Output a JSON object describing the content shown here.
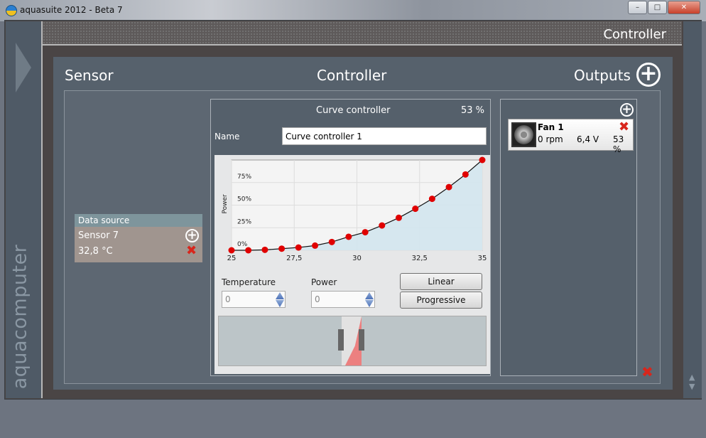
{
  "window": {
    "title": "aquasuite 2012 - Beta 7",
    "min": "–",
    "max": "□",
    "close": "✕"
  },
  "sidebar": {
    "brand": "aquacomputer"
  },
  "page_header": "Controller",
  "sections": {
    "sensor": "Sensor",
    "controller": "Controller",
    "outputs": "Outputs"
  },
  "data_source": {
    "header": "Data source",
    "sensor": "Sensor 7",
    "value": "32,8 °C"
  },
  "controller": {
    "type": "Curve controller",
    "power": "53 %",
    "name_label": "Name",
    "name_value": "Curve controller 1",
    "temperature_label": "Temperature",
    "temperature_value": "0",
    "power_label": "Power",
    "power_value": "0",
    "linear": "Linear",
    "progressive": "Progressive"
  },
  "outputs": [
    {
      "name": "Fan 1",
      "rpm": "0 rpm",
      "voltage": "6,4 V",
      "power": "53 %"
    }
  ],
  "chart_data": {
    "type": "line",
    "xlabel": "",
    "ylabel": "Power",
    "xlim": [
      25,
      35
    ],
    "ylim": [
      0,
      100
    ],
    "x_ticks": [
      "25",
      "27,5",
      "30",
      "32,5",
      "35"
    ],
    "y_ticks": [
      "0%",
      "25%",
      "50%",
      "75%"
    ],
    "grid": true,
    "x": [
      25,
      25.67,
      26.33,
      27,
      27.67,
      28.33,
      29,
      29.67,
      30.33,
      31,
      31.67,
      32.33,
      33,
      33.67,
      34.33,
      35
    ],
    "y": [
      0,
      0,
      0.5,
      1.8,
      3.1,
      5.2,
      9.2,
      15,
      20,
      27.5,
      36,
      46,
      57,
      70,
      84,
      100
    ]
  }
}
